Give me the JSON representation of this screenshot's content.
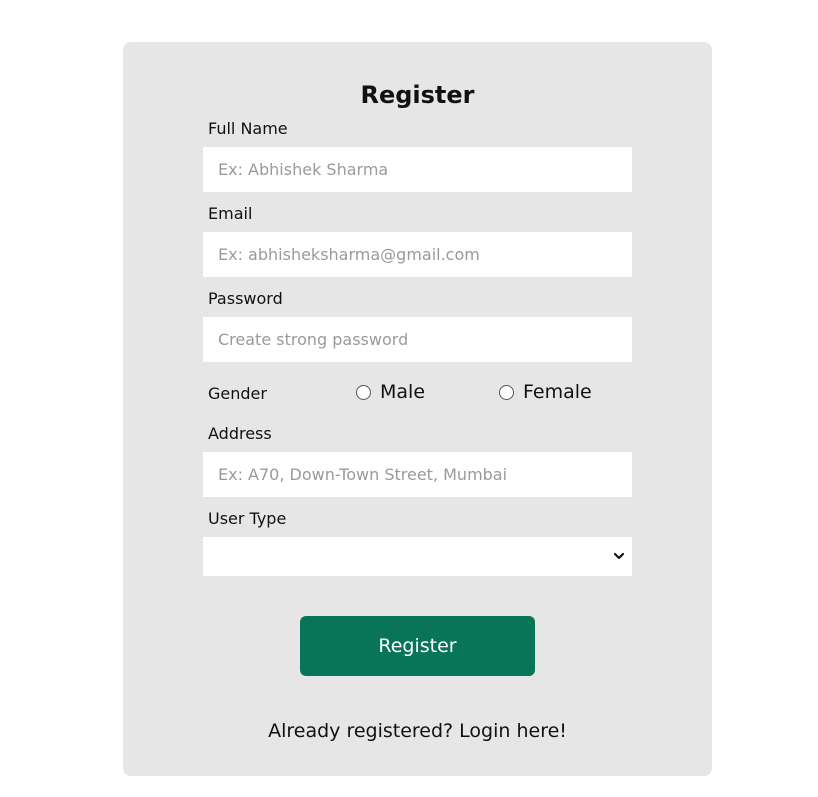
{
  "form": {
    "title": "Register",
    "full_name": {
      "label": "Full Name",
      "value": "",
      "placeholder": "Ex: Abhishek Sharma"
    },
    "email": {
      "label": "Email",
      "value": "",
      "placeholder": "Ex: abhisheksharma@gmail.com"
    },
    "password": {
      "label": "Password",
      "value": "",
      "placeholder": "Create strong password"
    },
    "gender": {
      "label": "Gender",
      "options": [
        "Male",
        "Female"
      ],
      "selected": null
    },
    "address": {
      "label": "Address",
      "value": "",
      "placeholder": "Ex: A70, Down-Town Street, Mumbai"
    },
    "user_type": {
      "label": "User Type",
      "selected_value": ""
    },
    "submit_label": "Register",
    "login_text": "Already registered? Login here!"
  },
  "colors": {
    "page_background": "#ffffff",
    "card_background": "#e6e6e6",
    "button_background": "#087559",
    "button_text": "#ffffff",
    "placeholder_text": "#9a9a9a"
  },
  "icons": {
    "select_chevron": "chevron-down-icon",
    "radio_unchecked": "radio-unchecked-icon"
  }
}
